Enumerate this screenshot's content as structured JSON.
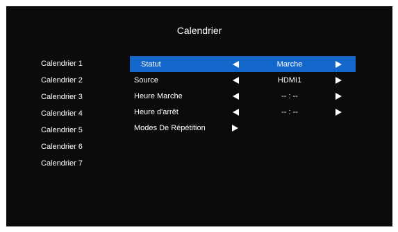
{
  "title": "Calendrier",
  "calendars": [
    "Calendrier 1",
    "Calendrier 2",
    "Calendrier 3",
    "Calendrier 4",
    "Calendrier 5",
    "Calendrier 6",
    "Calendrier 7"
  ],
  "settings": {
    "statut": {
      "label": "Statut",
      "value": "Marche"
    },
    "source": {
      "label": "Source",
      "value": "HDMI1"
    },
    "heure_marche": {
      "label": "Heure Marche",
      "value": "-- : --"
    },
    "heure_arret": {
      "label": "Heure d'arrêt",
      "value": "-- : --"
    },
    "modes_repetition": {
      "label": "Modes De Répétition"
    }
  },
  "colors": {
    "background": "#0b0b0b",
    "highlight": "#1468cc",
    "text": "#ffffff"
  },
  "icons": {
    "left_arrow": "triangle-left-icon",
    "right_arrow": "triangle-right-icon"
  }
}
